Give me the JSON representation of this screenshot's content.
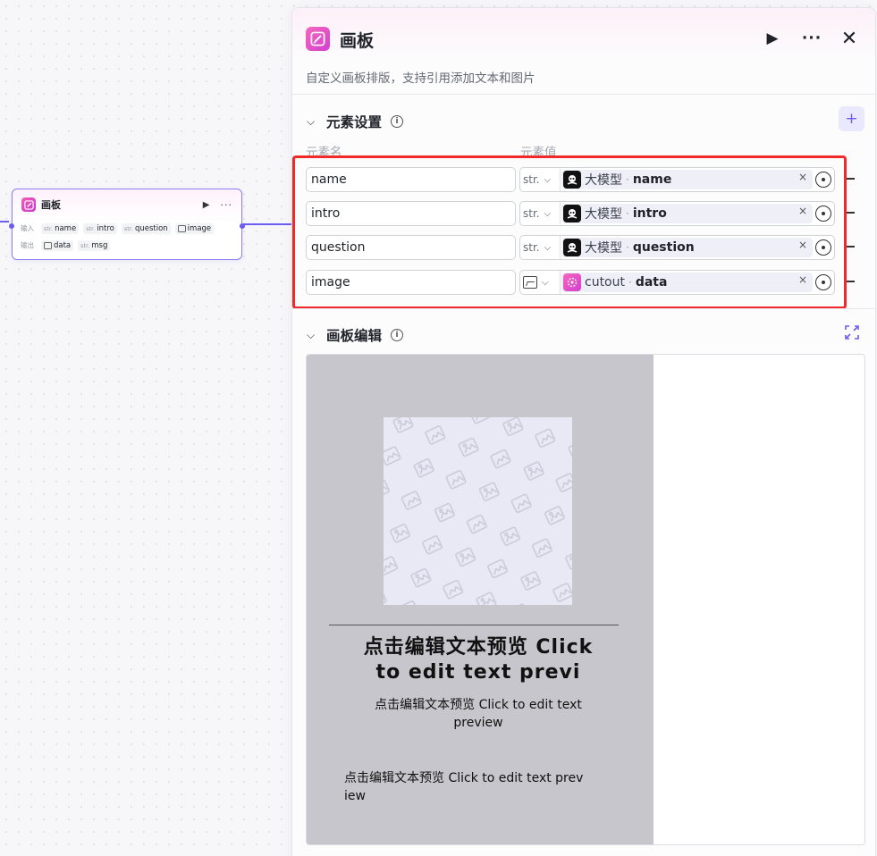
{
  "node": {
    "title": "画板",
    "input_label": "输入",
    "output_label": "输出",
    "inputs": [
      {
        "type": "str.",
        "name": "name"
      },
      {
        "type": "str.",
        "name": "intro"
      },
      {
        "type": "str.",
        "name": "question"
      },
      {
        "type": "image-icon",
        "name": "image"
      }
    ],
    "outputs": [
      {
        "type": "image-icon",
        "name": "data"
      },
      {
        "type": "str.",
        "name": "msg"
      }
    ]
  },
  "panel": {
    "title": "画板",
    "description": "自定义画板排版，支持引用添加文本和图片",
    "elements_section": {
      "title": "元素设置",
      "col_name": "元素名",
      "col_value": "元素值",
      "rows": [
        {
          "name": "name",
          "type": "str.",
          "ref_node": "大模型",
          "ref_field": "name"
        },
        {
          "name": "intro",
          "type": "str.",
          "ref_node": "大模型",
          "ref_field": "intro"
        },
        {
          "name": "question",
          "type": "str.",
          "ref_node": "大模型",
          "ref_field": "question"
        },
        {
          "name": "image",
          "type": "image-icon",
          "ref_node": "cutout",
          "ref_field": "data"
        }
      ]
    },
    "board_section": {
      "title": "画板编辑",
      "preview_title": "点击编辑文本预览 Click to edit text previ",
      "preview_text1": "点击编辑文本预览 Click to edit text preview",
      "preview_text2": "点击编辑文本预览 Click to edit text preview"
    }
  },
  "colors": {
    "accent": "#6b5cf2",
    "brand_pink": "#e94fc0",
    "highlight_border": "#ee2a2a",
    "board_bg": "#c6c6cc"
  }
}
